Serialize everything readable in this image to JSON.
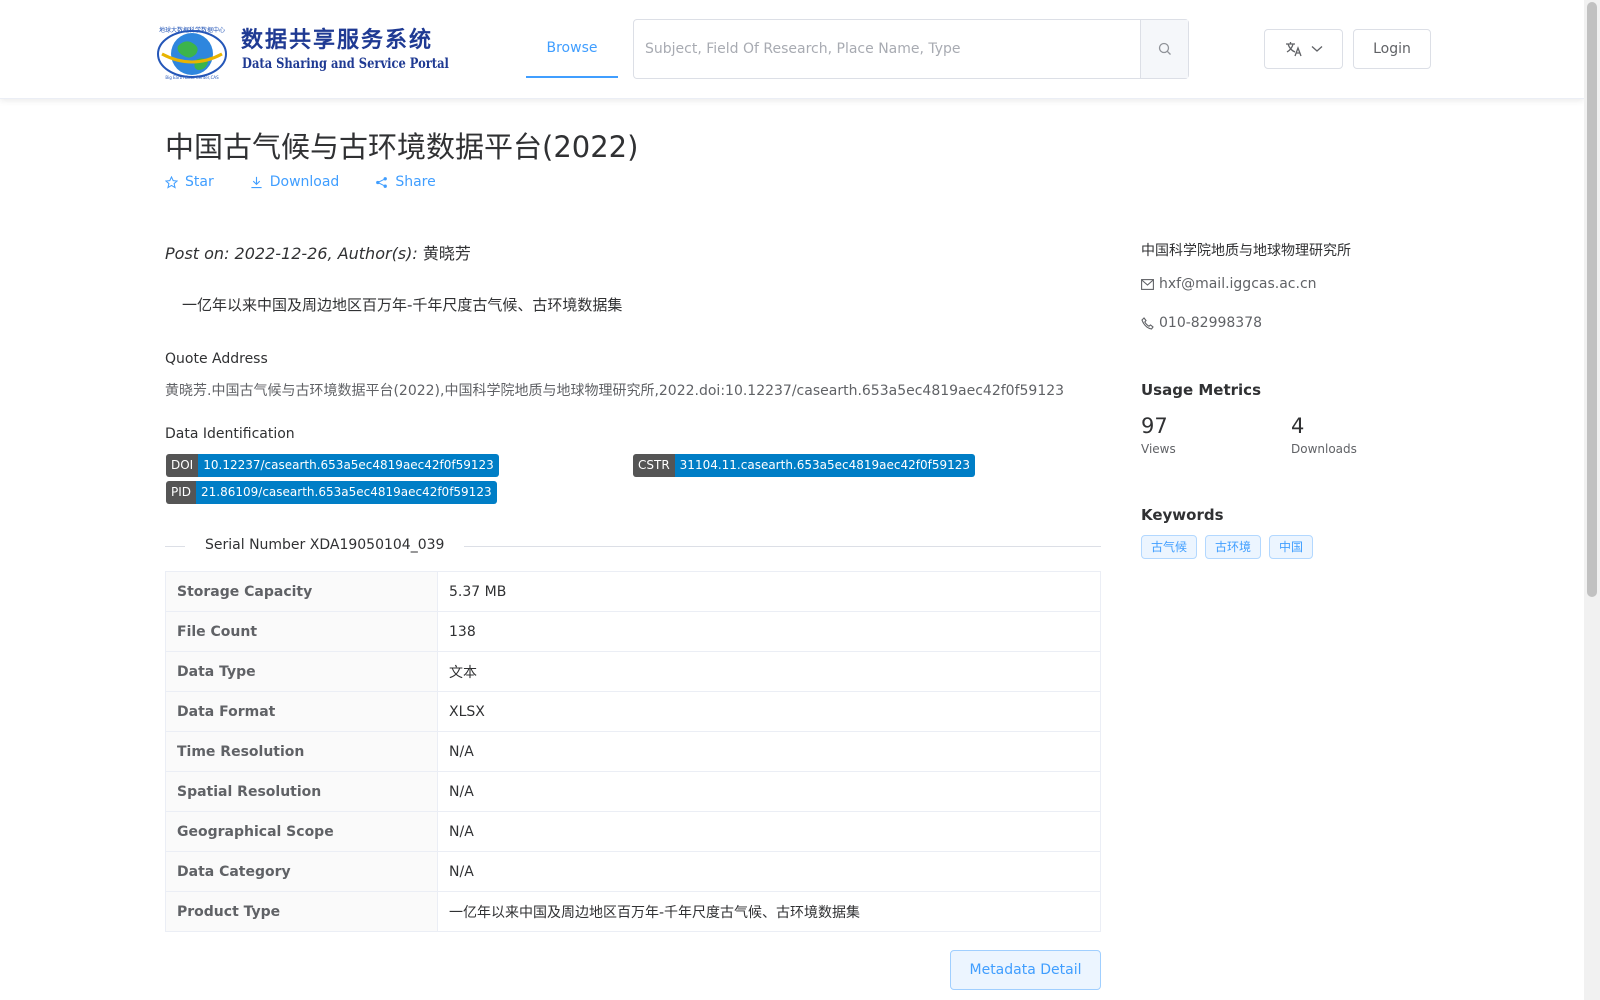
{
  "header": {
    "logo": {
      "title_cn": "数据共享服务系统",
      "title_en": "Data Sharing and Service Portal",
      "ring_text_top": "地球大数据科学数据中心",
      "ring_text_bottom": "Big Earth Data Center,CAS"
    },
    "nav_browse": "Browse",
    "search_placeholder": "Subject, Field Of Research, Place Name, Type",
    "login": "Login"
  },
  "dataset": {
    "title": "中国古气候与古环境数据平台(2022)",
    "actions": {
      "star": "Star",
      "download": "Download",
      "share": "Share"
    },
    "post_prefix": "Post on: 2022-12-26, Author(s): ",
    "author": "黄晓芳",
    "summary": "一亿年以来中国及周边地区百万年-千年尺度古气候、古环境数据集",
    "quote_label": "Quote Address",
    "quote": "黄晓芳.中国古气候与古环境数据平台(2022),中国科学院地质与地球物理研究所,2022.doi:10.12237/casearth.653a5ec4819aec42f0f59123",
    "identification_label": "Data Identification",
    "ids": {
      "doi": {
        "key": "DOI",
        "value": "10.12237/casearth.653a5ec4819aec42f0f59123"
      },
      "cstr": {
        "key": "CSTR",
        "value": "31104.11.casearth.653a5ec4819aec42f0f59123"
      },
      "pid": {
        "key": "PID",
        "value": "21.86109/casearth.653a5ec4819aec42f0f59123"
      }
    },
    "serial": "Serial Number XDA19050104_039",
    "specs": [
      {
        "key": "Storage Capacity",
        "value": "5.37 MB"
      },
      {
        "key": "File Count",
        "value": "138"
      },
      {
        "key": "Data Type",
        "value": "文本"
      },
      {
        "key": "Data Format",
        "value": "XLSX"
      },
      {
        "key": "Time Resolution",
        "value": "N/A"
      },
      {
        "key": "Spatial Resolution",
        "value": "N/A"
      },
      {
        "key": "Geographical Scope",
        "value": "N/A"
      },
      {
        "key": "Data Category",
        "value": "N/A"
      },
      {
        "key": "Product Type",
        "value": "一亿年以来中国及周边地区百万年-千年尺度古气候、古环境数据集"
      }
    ],
    "metadata_button": "Metadata Detail"
  },
  "sidebar": {
    "org": "中国科学院地质与地球物理研究所",
    "email": "hxf@mail.iggcas.ac.cn",
    "phone": "010-82998378",
    "usage_title": "Usage Metrics",
    "views": {
      "value": "97",
      "label": "Views"
    },
    "downloads": {
      "value": "4",
      "label": "Downloads"
    },
    "keywords_title": "Keywords",
    "keywords": [
      "古气候",
      "古环境",
      "中国"
    ]
  },
  "colors": {
    "accent": "#409eff",
    "badge_key": "#555555",
    "badge_value": "#007ec6"
  },
  "icons": [
    "globe-logo-icon",
    "search-icon",
    "translate-icon",
    "chevron-down-icon",
    "star-icon",
    "download-icon",
    "share-icon",
    "mail-icon",
    "phone-icon"
  ]
}
